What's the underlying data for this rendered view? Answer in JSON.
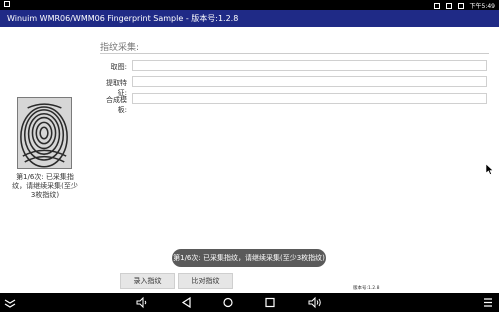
{
  "statusbar": {
    "time": "下午5:49"
  },
  "app": {
    "title": "Winuim WMR06/WMM06 Fingerprint Sample - 版本号:1.2.8"
  },
  "fingerprint": {
    "status_text": "第1/6次: 已采集指纹，请继续采集(至少3枚指纹)"
  },
  "form": {
    "section_title": "指纹采集:",
    "fields": [
      {
        "label": "取图:",
        "value": ""
      },
      {
        "label": "提取特征:",
        "value": ""
      },
      {
        "label": "合成模板:",
        "value": ""
      }
    ]
  },
  "toast": {
    "text": "第1/6次: 已采集指纹，请继续采集(至少3枚指纹)"
  },
  "buttons": {
    "enroll": "录入指纹",
    "verify": "比对指纹"
  },
  "footer": {
    "version": "版本号:1.2.8"
  },
  "icons": {
    "nav": [
      "collapse-icon",
      "volume-down-icon",
      "back-icon",
      "home-icon",
      "recents-icon",
      "volume-up-icon",
      "menu-icon"
    ]
  }
}
